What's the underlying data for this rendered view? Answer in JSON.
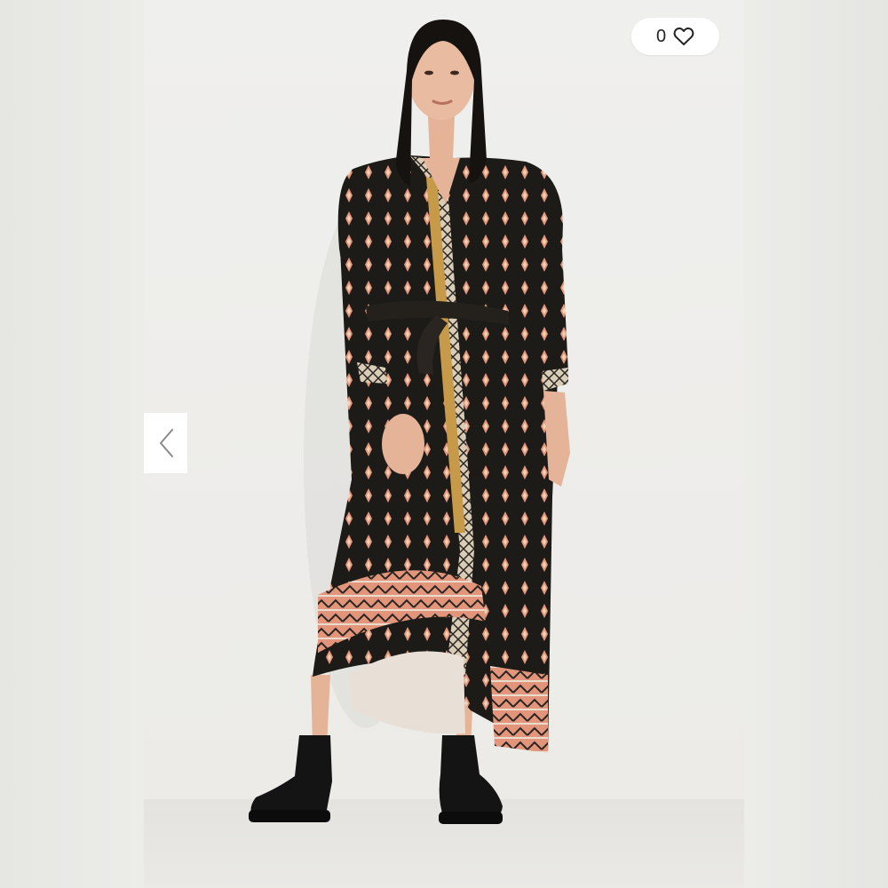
{
  "gallery": {
    "likes": {
      "count": "0",
      "icon": "heart-outline-icon"
    },
    "prev_icon": "chevron-left-icon",
    "colors": {
      "dress_base": "#1c1b18",
      "dress_accent_peach": "#e2957a",
      "dress_accent_mustard": "#c79a4a",
      "boots": "#141414"
    }
  }
}
